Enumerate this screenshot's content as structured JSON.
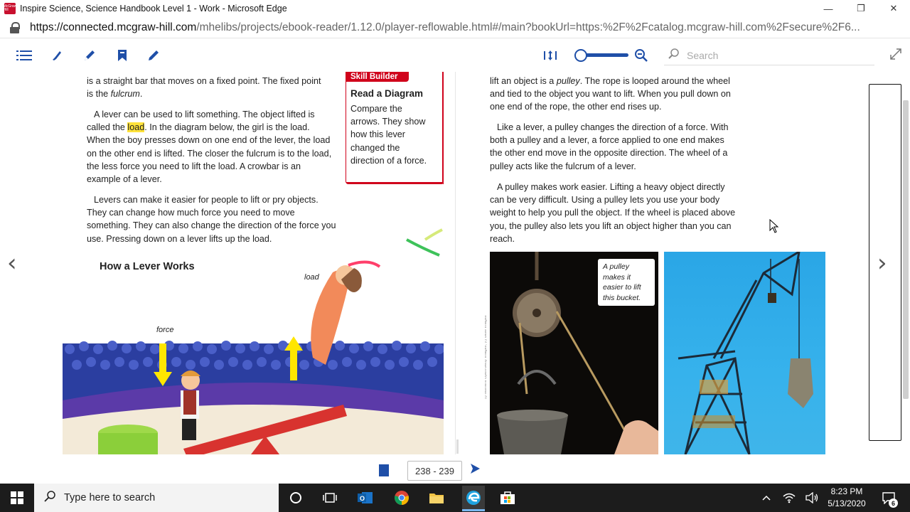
{
  "window": {
    "title": "Inspire Science, Science Handbook Level 1 - Work - Microsoft Edge",
    "logo_text": "McGraw Hill"
  },
  "address_bar": {
    "host": "https://connected.mcgraw-hill.com",
    "path": "/mhelibs/projects/ebook-reader/1.12.0/player-reflowable.html#/main?bookUrl=https:%2F%2Fcatalog.mcgraw-hill.com%2Fsecure%2F6..."
  },
  "reader_toolbar": {
    "search_placeholder": "Search",
    "icons": [
      "list-icon",
      "highlighter-icon",
      "pen-icon",
      "bookmark-icon",
      "pencil-icon",
      "fit-page-icon",
      "zoom-out-icon",
      "expand-icon"
    ]
  },
  "left_page": {
    "p1_a": "is a straight bar that moves on a fixed point. The fixed point is the ",
    "p1_em": "fulcrum",
    "p1_b": ".",
    "p2_a": "A lever can be used to lift something. The object lifted is called the ",
    "p2_hl": "load",
    "p2_b": ". In the diagram below, the girl is the load. When the boy presses down on one end of the lever, the load on the other end is lifted. The closer the fulcrum is to the load, the less force you need to lift the load. A crowbar is an example of a lever.",
    "p3": "Levers can make it easier for people to lift or pry objects. They can change how much force you need to move something. They can also change the direction of the force you use. Pressing down on a lever lifts up the load.",
    "skill_builder": {
      "tag": "Skill Builder",
      "heading": "Read a Diagram",
      "body": "Compare the arrows. They show how this lever changed the direction of a force."
    },
    "diagram_title": "How a Lever Works",
    "label_load": "load",
    "label_force": "force"
  },
  "right_page": {
    "p1_a": "lift an object is a ",
    "p1_em": "pulley",
    "p1_b": ". The rope is looped around the wheel and tied to the object you want to lift. When you pull down on one end of the rope, the other end rises up.",
    "p2": "Like a lever, a pulley changes the direction of a force. With both a pulley and a lever, a force applied to one end makes the other end move in the opposite direction. The wheel of a pulley acts like the fulcrum of a lever.",
    "p3": "A pulley makes work easier.  Lifting a heavy object directly can be very difficult. Using a pulley lets you use your body weight to help you pull the object. If the wheel is placed above you, the pulley also lets you lift an object higher than you can reach.",
    "photo_caption": "A pulley makes it easier to lift this bucket.",
    "photo_credit": "(l) Moment Open/Getty Images; (r) Glow Images"
  },
  "page_nav": {
    "page_range": "238 - 239"
  },
  "taskbar": {
    "search_placeholder": "Type here to search",
    "time": "8:23 PM",
    "date": "5/13/2020",
    "notification_count": "6"
  }
}
